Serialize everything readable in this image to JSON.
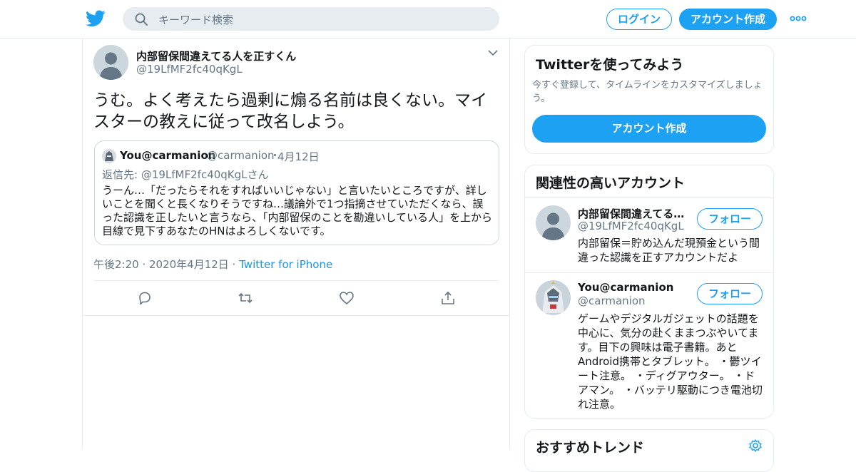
{
  "header": {
    "search_placeholder": "キーワード検索",
    "login_label": "ログイン",
    "signup_label": "アカウント作成"
  },
  "tweet": {
    "name": "内部留保間違えてる人を正すくん",
    "handle": "@19LfMF2fc40qKgL",
    "text": "うむ。よく考えたら過剰に煽る名前は良くない。マイスターの教えに従って改名しよう。",
    "quote": {
      "name": "You@carmanion",
      "handle": "@carmanion",
      "dot": "・",
      "date": "4月12日",
      "reply_to": "返信先: @19LfMF2fc40qKgLさん",
      "text": "うーん…「だったらそれをすればいいじゃない」と言いたいところですが、詳しいことを聞くと長くなりそうですね…議論外で1つ指摘させていただくなら、誤った認識を正したいと言うなら、「内部留保のことを勘違いしている人」を上から目線で見下すあなたのHNはよろしくないです。"
    },
    "timestamp": "午後2:20 · 2020年4月12日 ·",
    "via": "Twitter for iPhone"
  },
  "sidebar": {
    "try_card": {
      "title": "Twitterを使ってみよう",
      "subtitle": "今すぐ登録して、タイムラインをカスタマイズしましょう。",
      "button": "アカウント作成"
    },
    "related": {
      "title": "関連性の高いアカウント",
      "accounts": [
        {
          "name": "内部留保間違えてる…",
          "handle": "@19LfMF2fc40qKgL",
          "bio": "内部留保＝貯め込んだ現預金という間違った認識を正すアカウントだよ",
          "follow": "フォロー"
        },
        {
          "name": "You@carmanion",
          "handle": "@carmanion",
          "bio": "ゲームやデジタルガジェットの話題を中心に、気分の赴くままつぶやいてます。目下の興味は電子書籍。あとAndroid携帯とタブレット。 ・鬱ツイート注意。 ・ディグアウター。 ・ドアマン。 ・バッテリ駆動につき電池切れ注意。",
          "follow": "フォロー"
        }
      ]
    },
    "trends": {
      "title": "おすすめトレンド"
    }
  },
  "colors": {
    "brand": "#1da1f2",
    "secondary_text": "#657786",
    "border": "#e6ecf0"
  }
}
